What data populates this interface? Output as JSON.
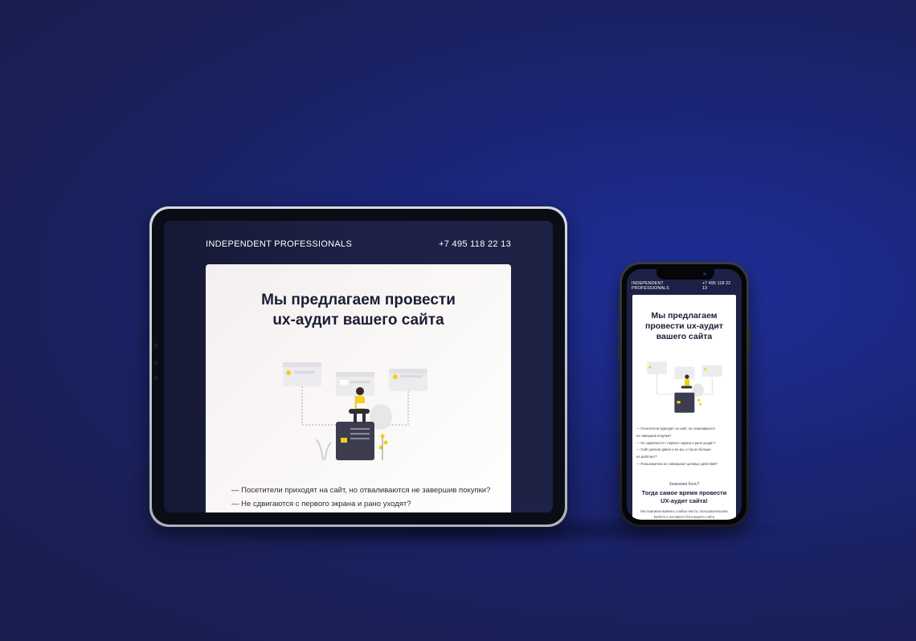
{
  "tablet": {
    "header": {
      "brand": "INDEPENDENT PROFESSIONALS",
      "phone": "+7 495 118 22 13"
    },
    "hero": {
      "title_line1": "Мы предлагаем провести",
      "title_line2": "ux-аудит вашего сайта"
    },
    "pain_points": [
      "—  Посетители приходят на сайт, но отваливаются не завершив покупки?",
      "—  Не сдвигаются с первого экрана и рано уходят?"
    ]
  },
  "phone": {
    "header": {
      "brand": "INDEPENDENT PROFESSIONALS",
      "phone": "+7 495 118 22 13"
    },
    "hero": {
      "title_line1": "Мы предлагаем",
      "title_line2": "провести ux-аудит",
      "title_line3": "вашего сайта"
    },
    "pain_points": [
      "—  Посетители приходят на сайт, но отваливаются",
      "не завершив покупки?",
      "—  Не сдвигаются с первого экрана и рано уходят?",
      "—  Сайт делали давно и не вы, и так он больше",
      "не работает?",
      "—  Пользователи не совершают целевых действий?"
    ],
    "familiar": "Знакомая боль?",
    "cta_line1": "Тогда самое время провести",
    "cta_line2": "UX-аудит сайта!",
    "body_line1": "Мы поможем выявить слабые места, пользовательские",
    "body_line2": "barriers и заставите бота вашего сайта"
  },
  "colors": {
    "background": "#1b2577",
    "screen": "#1d2146",
    "card": "#ffffff",
    "accent_yellow": "#f5cf1b",
    "title": "#1b1d36"
  }
}
